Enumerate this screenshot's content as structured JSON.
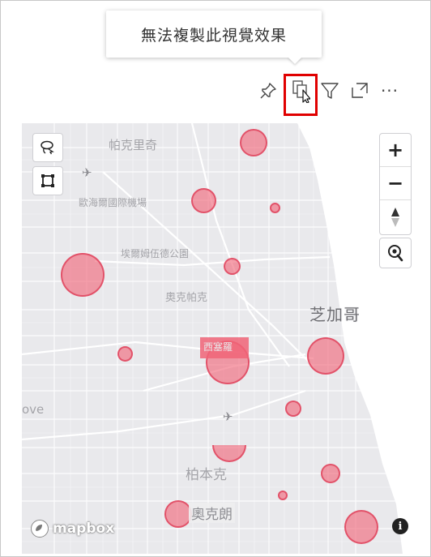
{
  "tooltip": {
    "text": "無法複製此視覺效果"
  },
  "toolbar": {
    "icons": [
      "pin-icon",
      "copy-icon",
      "filter-icon",
      "focus-mode-icon",
      "more-options-icon"
    ],
    "more_label": "···",
    "highlight_color": "#e00000"
  },
  "map": {
    "labels": {
      "park_ridge_partial": "ove",
      "park_ridge": "帕克里奇",
      "ohare": "歐海爾國際機場",
      "elmwood_park": "埃爾姆伍德公園",
      "oak_park": "奧克帕克",
      "chicago": "芝加哥",
      "grove_partial": "ove",
      "burbank": "柏本克",
      "oak_lawn": "奧克朗",
      "cicero": "西塞羅"
    },
    "controls": {
      "zoom_in": "+",
      "zoom_out": "−",
      "attribution": "i"
    },
    "attribution_logo": "mapbox",
    "bubble_color": "#f06478"
  }
}
